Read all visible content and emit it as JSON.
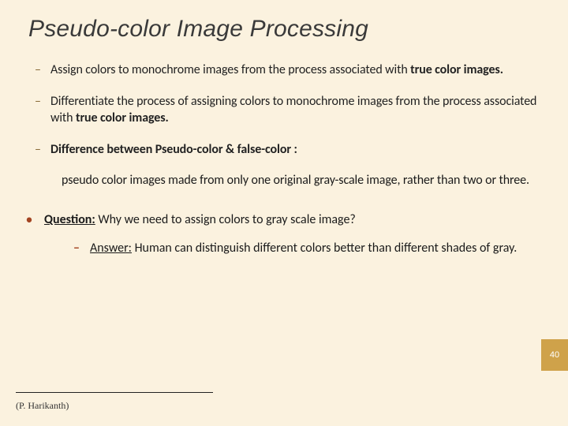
{
  "title": "Pseudo-color Image Processing",
  "items": {
    "i1": {
      "text_a": "Assign colors to monochrome images from the process associated with ",
      "bold_tail": "true color images."
    },
    "i2": {
      "text_a": "Differentiate the process of assigning colors to monochrome images from the process associated with ",
      "bold_tail": "true color images."
    },
    "i3": {
      "bold_all": "Difference between Pseudo-color  & false-color :"
    }
  },
  "sub_paragraph": "pseudo color images made from only one original gray-scale image, rather than two or three.",
  "question": {
    "label": "Question:",
    "text": " Why we need to assign colors to gray scale image?"
  },
  "answer": {
    "label": "Answer:",
    "text": " Human can distinguish different colors better than different shades of gray."
  },
  "attribution": "(P. Harikanth)",
  "page_number": "40",
  "glyphs": {
    "dash": "–",
    "bullet": "•"
  }
}
